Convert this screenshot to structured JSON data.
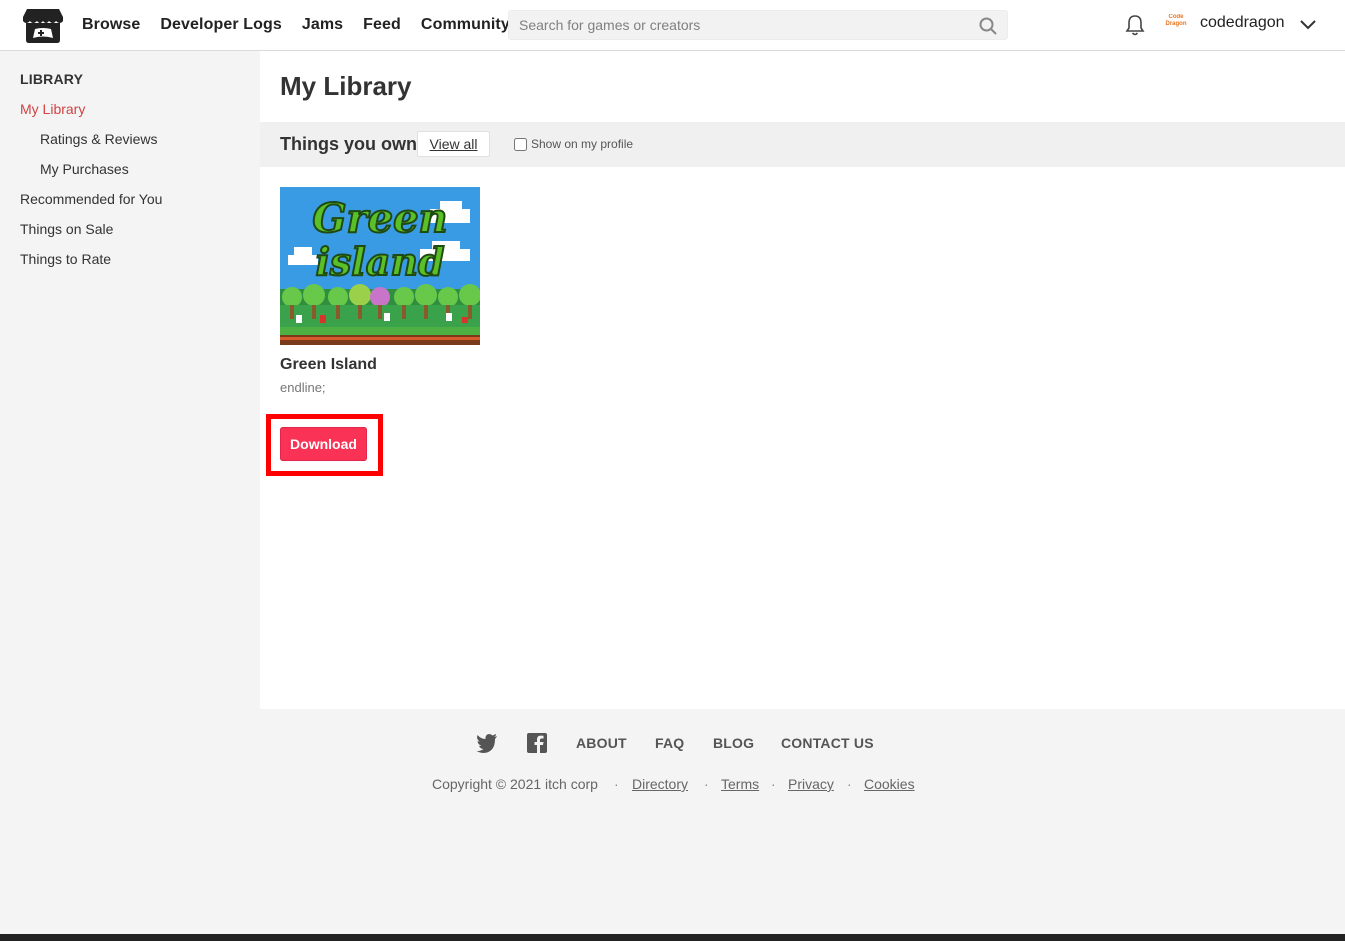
{
  "header": {
    "nav": [
      "Browse",
      "Developer Logs",
      "Jams",
      "Feed",
      "Community"
    ],
    "search_placeholder": "Search for games or creators",
    "avatar_text": "Code Dragon",
    "username": "codedragon"
  },
  "sidebar": {
    "heading": "LIBRARY",
    "items": [
      {
        "label": "My Library",
        "active": true
      },
      {
        "label": "Ratings & Reviews"
      },
      {
        "label": "My Purchases"
      },
      {
        "label": "Recommended for You"
      },
      {
        "label": "Things on Sale"
      },
      {
        "label": "Things to Rate"
      }
    ]
  },
  "main": {
    "title": "My Library",
    "section_title": "Things you own",
    "view_all": "View all",
    "show_on_profile": "Show on my profile",
    "game": {
      "cover_text_1": "Green",
      "cover_text_2": "island",
      "title": "Green Island",
      "author": "endline;",
      "download_label": "Download"
    }
  },
  "footer": {
    "links": [
      "ABOUT",
      "FAQ",
      "BLOG",
      "CONTACT US"
    ],
    "copyright": "Copyright © 2021 itch corp",
    "sub_links": [
      "Directory",
      "Terms",
      "Privacy",
      "Cookies"
    ],
    "separator": "·"
  },
  "colors": {
    "accent": "#d14343",
    "download_button": "#fa3255",
    "highlight_outline": "#ff0000"
  }
}
